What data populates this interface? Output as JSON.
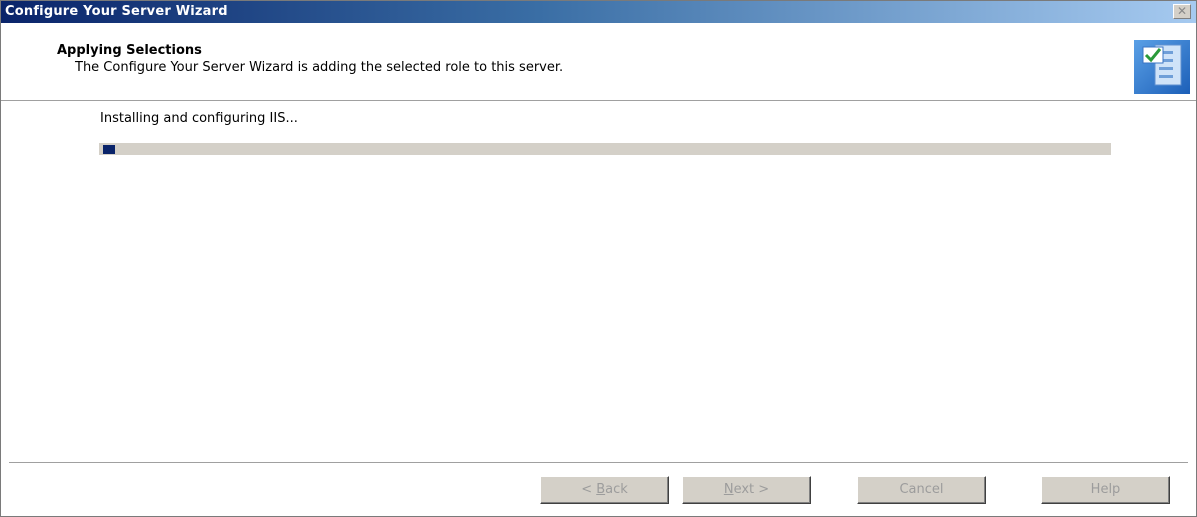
{
  "window": {
    "title": "Configure Your Server Wizard",
    "close_glyph": "✕"
  },
  "header": {
    "title": "Applying Selections",
    "subtitle": "The Configure Your Server Wizard is adding the selected role to this server.",
    "icon": "wizard-checklist-icon"
  },
  "main": {
    "status": "Installing and configuring IIS...",
    "progress_fraction": 0.01
  },
  "buttons": {
    "back": {
      "pre": "< ",
      "key": "B",
      "post": "ack",
      "enabled": false
    },
    "next": {
      "pre": "",
      "key": "N",
      "post": "ext >",
      "enabled": false
    },
    "cancel": {
      "label": "Cancel",
      "enabled": false
    },
    "help": {
      "label": "Help",
      "enabled": false
    }
  },
  "colors": {
    "title_dark": "#0a246a",
    "title_light": "#a6caf0",
    "face": "#d4d0c8",
    "progress_chunk": "#0a246a",
    "disabled_text": "#9c9c9c"
  }
}
